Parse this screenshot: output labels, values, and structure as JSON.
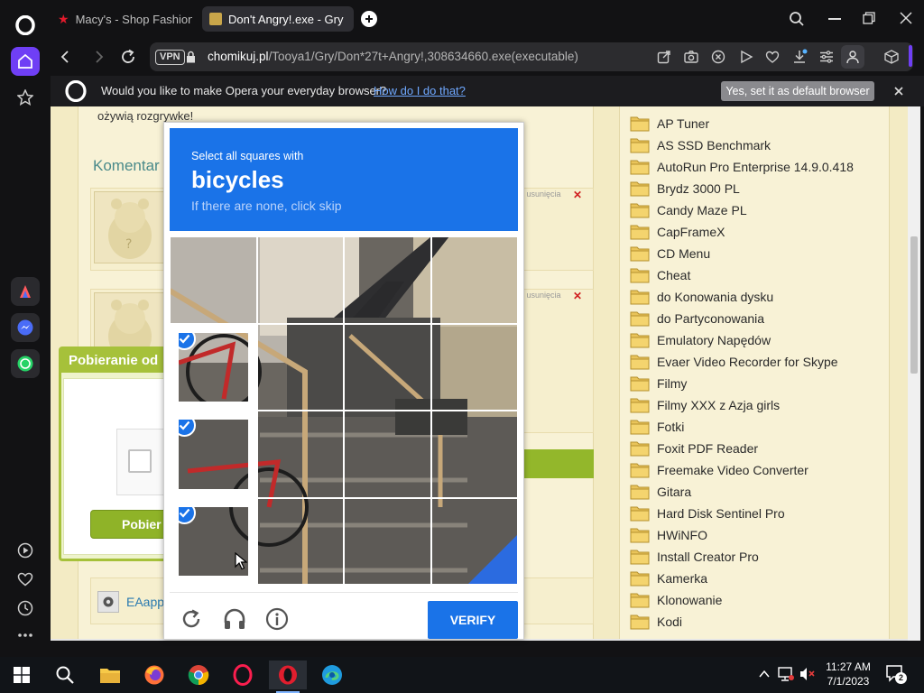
{
  "browser": {
    "tabs": [
      {
        "label": "Macy's - Shop Fashion Clo",
        "active": false
      },
      {
        "label": "Don't Angry!.exe - Gry - T",
        "active": true
      }
    ],
    "vpn_label": "VPN",
    "url": {
      "host": "chomikuj.pl",
      "path": "/Tooya1/Gry/Don*27t+Angry!,308634660.exe(executable)"
    },
    "infobar": {
      "message": "Would you like to make Opera your everyday browser?",
      "link": "How do I do that?",
      "button": "Yes, set it as default browser"
    }
  },
  "page": {
    "snippet_line1": "ożywią rozgrywke!",
    "comments_heading": "Komentar",
    "delete_hint_1": "o usunięcia",
    "delete_hint_2": "o usunięcia",
    "download_box_title": "Pobieranie od",
    "download_button": "Pobier",
    "file_label": "EAappl",
    "folders": [
      "AP Tuner",
      "AS SSD Benchmark",
      "AutoRun Pro Enterprise 14.9.0.418",
      "Brydz 3000 PL",
      "Candy Maze PL",
      "CapFrameX",
      "CD Menu",
      "Cheat",
      "do Konowania dysku",
      "do Partyconowania",
      "Emulatory Napędów",
      "Evaer Video Recorder for Skype",
      "Filmy",
      "Filmy XXX z Azja girls",
      "Fotki",
      "Foxit PDF Reader",
      "Freemake Video Converter",
      "Gitara",
      "Hard Disk Sentinel Pro",
      "HWiNFO",
      "Install Creator Pro",
      "Kamerka",
      "Klonowanie",
      "Kodi"
    ]
  },
  "captcha": {
    "instruction": "Select all squares with",
    "target": "bicycles",
    "hint": "If there are none, click skip",
    "verify_label": "VERIFY",
    "selected_tiles": [
      4,
      8,
      12
    ],
    "accent_color": "#1a73e8"
  },
  "taskbar": {
    "time": "11:27 AM",
    "date": "7/1/2023",
    "notification_count": "2"
  }
}
